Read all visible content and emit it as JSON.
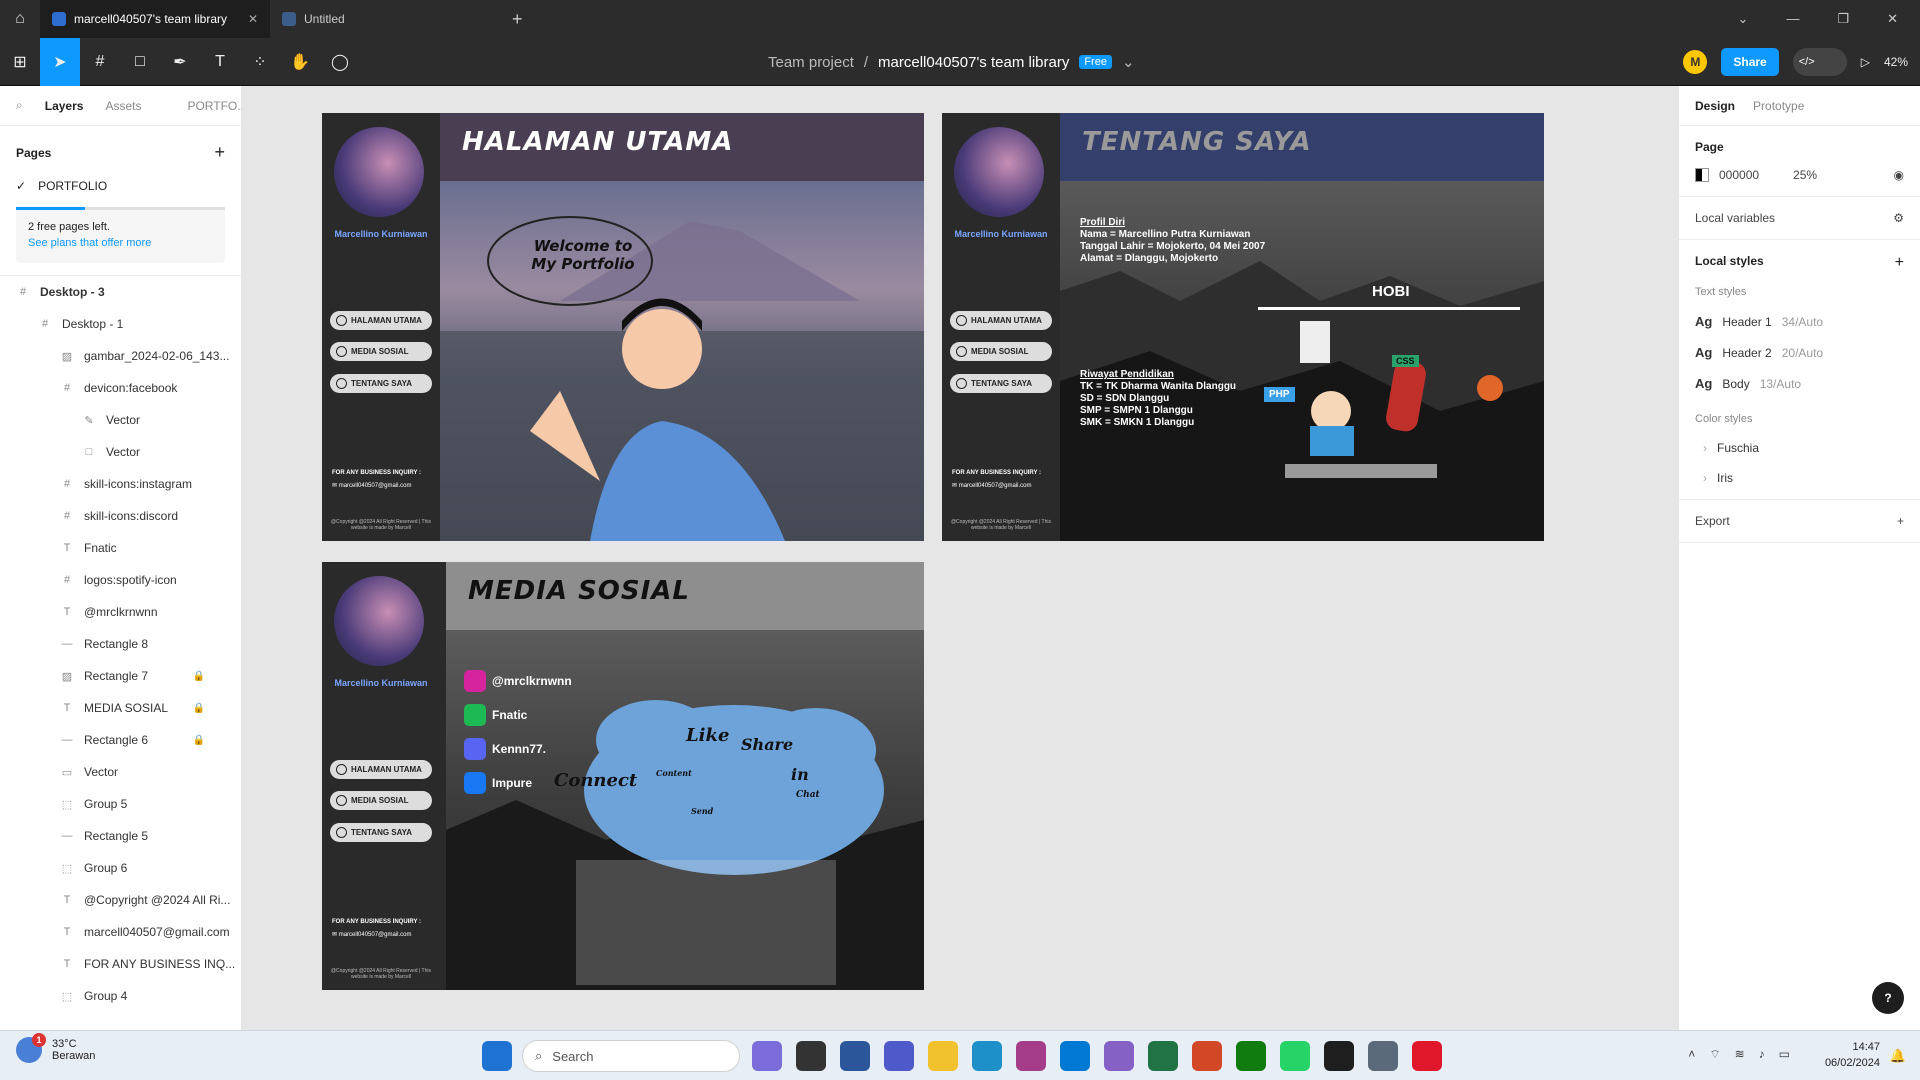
{
  "tabs": [
    {
      "label": "marcell040507's team library",
      "active": true
    },
    {
      "label": "Untitled",
      "active": false
    }
  ],
  "breadcrumb": {
    "project": "Team project",
    "separator": "/",
    "file": "marcell040507's team library",
    "plan_badge": "Free"
  },
  "toolbar_right": {
    "avatar_initial": "M",
    "share_label": "Share",
    "zoom": "42%"
  },
  "left_panel": {
    "tabs": [
      "Layers",
      "Assets",
      "PORTFO..."
    ],
    "pages_title": "Pages",
    "pages": [
      "PORTFOLIO"
    ],
    "upsell_text": "2 free pages left.",
    "upsell_link": "See plans that offer more",
    "upsell_progress": 0.33,
    "layers": [
      {
        "name": "Desktop - 3",
        "icon": "#",
        "indent": 0,
        "locked": false
      },
      {
        "name": "Desktop - 1",
        "icon": "#",
        "indent": 1,
        "locked": false
      },
      {
        "name": "gambar_2024-02-06_143...",
        "icon": "▨",
        "indent": 2,
        "locked": false
      },
      {
        "name": "devicon:facebook",
        "icon": "#",
        "indent": 2,
        "locked": false
      },
      {
        "name": "Vector",
        "icon": "✎",
        "indent": 3,
        "locked": false
      },
      {
        "name": "Vector",
        "icon": "□",
        "indent": 3,
        "locked": false
      },
      {
        "name": "skill-icons:instagram",
        "icon": "#",
        "indent": 2,
        "locked": false
      },
      {
        "name": "skill-icons:discord",
        "icon": "#",
        "indent": 2,
        "locked": false
      },
      {
        "name": "Fnatic",
        "icon": "T",
        "indent": 2,
        "locked": false
      },
      {
        "name": "logos:spotify-icon",
        "icon": "#",
        "indent": 2,
        "locked": false
      },
      {
        "name": "@mrclkrnwnn",
        "icon": "T",
        "indent": 2,
        "locked": false
      },
      {
        "name": "Rectangle 8",
        "icon": "—",
        "indent": 2,
        "locked": false
      },
      {
        "name": "Rectangle 7",
        "icon": "▨",
        "indent": 2,
        "locked": true
      },
      {
        "name": "MEDIA SOSIAL",
        "icon": "T",
        "indent": 2,
        "locked": true
      },
      {
        "name": "Rectangle 6",
        "icon": "—",
        "indent": 2,
        "locked": true
      },
      {
        "name": "Vector",
        "icon": "▭",
        "indent": 2,
        "locked": false
      },
      {
        "name": "Group 5",
        "icon": "⬚",
        "indent": 2,
        "locked": false
      },
      {
        "name": "Rectangle 5",
        "icon": "—",
        "indent": 2,
        "locked": false
      },
      {
        "name": "Group 6",
        "icon": "⬚",
        "indent": 2,
        "locked": false
      },
      {
        "name": "@Copyright @2024 All Ri...",
        "icon": "T",
        "indent": 2,
        "locked": false
      },
      {
        "name": "marcell040507@gmail.com",
        "icon": "T",
        "indent": 2,
        "locked": false
      },
      {
        "name": "FOR ANY BUSINESS INQ...",
        "icon": "T",
        "indent": 2,
        "locked": false
      },
      {
        "name": "Group 4",
        "icon": "⬚",
        "indent": 2,
        "locked": false
      }
    ]
  },
  "frames": {
    "shared": {
      "profile_name": "Marcellino Kurniawan",
      "nav": [
        "HALAMAN UTAMA",
        "MEDIA SOSIAL",
        "TENTANG SAYA"
      ],
      "business": "FOR ANY BUSINESS INQUIRY :",
      "email": "marcell040507@gmail.com",
      "copyright": "@Copyright @2024 All Right Reserved | This website is made by Marcell"
    },
    "home": {
      "title": "HALAMAN UTAMA",
      "bubble": "Welcome to My Portfolio"
    },
    "about": {
      "title": "TENTANG SAYA",
      "profile_heading": "Profil Diri",
      "profile_lines": [
        "Nama = Marcellino Putra Kurniawan",
        "Tanggal Lahir = Mojokerto, 04 Mei 2007",
        "Alamat = Dlanggu, Mojokerto"
      ],
      "edu_heading": "Riwayat Pendidikan",
      "edu_lines": [
        "TK = TK Dharma Wanita Dlanggu",
        "SD = SDN Dlanggu",
        "SMP = SMPN 1 Dlanggu",
        "SMK = SMKN 1 Dlanggu"
      ],
      "hobby_heading": "HOBI",
      "php": "PHP",
      "css": "CSS"
    },
    "social": {
      "title": "MEDIA SOSIAL",
      "accounts": [
        {
          "name": "@mrclkrnwnn",
          "icon": "instagram-icon",
          "color": "#d6249f"
        },
        {
          "name": "Fnatic",
          "icon": "spotify-icon",
          "color": "#1db954"
        },
        {
          "name": "Kennn77.",
          "icon": "discord-icon",
          "color": "#5865f2"
        },
        {
          "name": "Impure",
          "icon": "facebook-icon",
          "color": "#1877f2"
        }
      ],
      "cloud_words": [
        "Connect",
        "Like",
        "Share",
        "Content",
        "Send",
        "Chat",
        "in"
      ]
    }
  },
  "right_panel": {
    "tabs": [
      "Design",
      "Prototype"
    ],
    "page_label": "Page",
    "page_color": "000000",
    "page_opacity": "25%",
    "local_variables": "Local variables",
    "local_styles": "Local styles",
    "text_styles_label": "Text styles",
    "text_styles": [
      {
        "sample": "Ag",
        "name": "Header 1",
        "meta": "34/Auto"
      },
      {
        "sample": "Ag",
        "name": "Header 2",
        "meta": "20/Auto"
      },
      {
        "sample": "Ag",
        "name": "Body",
        "meta": "13/Auto"
      }
    ],
    "color_styles_label": "Color styles",
    "color_styles": [
      "Fuschia",
      "Iris"
    ],
    "export": "Export",
    "help": "?"
  },
  "taskbar": {
    "temp": "33°C",
    "weather": "Berawan",
    "badge": "1",
    "search": "Search",
    "time": "14:47",
    "date": "06/02/2024"
  },
  "colors": {
    "accent": "#0d99ff",
    "sidebar": "#2a2a2a"
  }
}
